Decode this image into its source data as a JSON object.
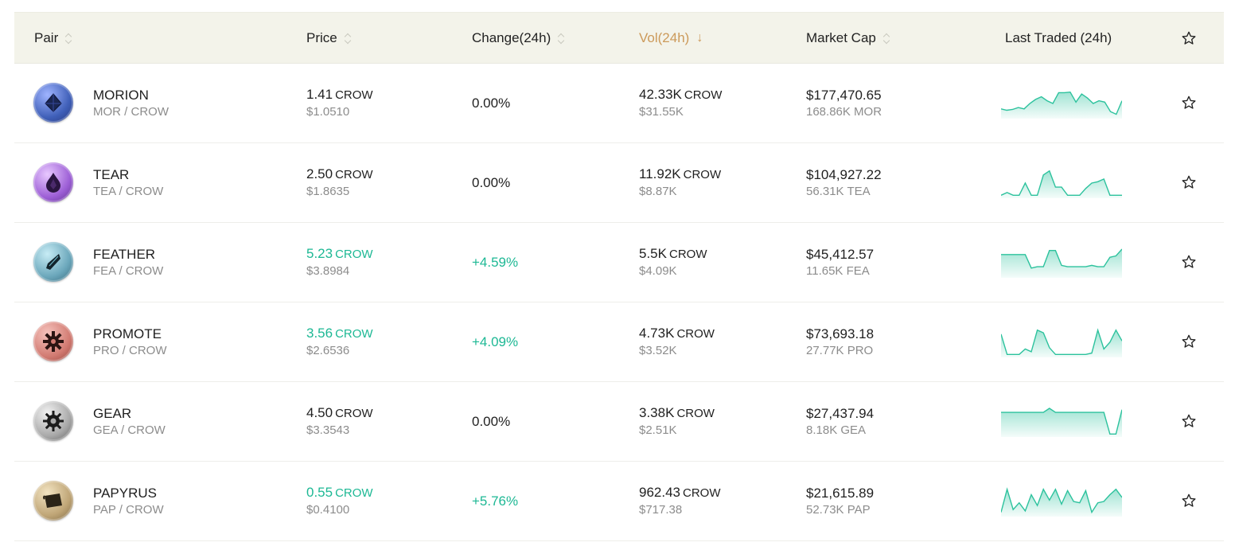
{
  "header": {
    "pair": "Pair",
    "price": "Price",
    "change": "Change(24h)",
    "vol": "Vol(24h)",
    "market_cap": "Market Cap",
    "last_traded": "Last Traded (24h)"
  },
  "colors": {
    "accent": "#cc9a5a",
    "positive": "#1db894",
    "spark_line": "#2cc29d",
    "header_bg": "#f3f3ea"
  },
  "rows": [
    {
      "name": "MORION",
      "pair": "MOR / CROW",
      "price": "1.41",
      "price_unit": "CROW",
      "price_usd": "$1.0510",
      "change": "0.00%",
      "vol": "42.33K",
      "vol_unit": "CROW",
      "vol_usd": "$31.55K",
      "mcap": "$177,470.65",
      "mcap_sub": "168.86K MOR",
      "positive": false,
      "icon": "morion-coin-icon",
      "spark": [
        0.3,
        0.25,
        0.28,
        0.35,
        0.3,
        0.5,
        0.65,
        0.75,
        0.6,
        0.5,
        0.9,
        0.9,
        0.92,
        0.55,
        0.85,
        0.7,
        0.5,
        0.6,
        0.55,
        0.2,
        0.1,
        0.6
      ]
    },
    {
      "name": "TEAR",
      "pair": "TEA / CROW",
      "price": "2.50",
      "price_unit": "CROW",
      "price_usd": "$1.8635",
      "change": "0.00%",
      "vol": "11.92K",
      "vol_unit": "CROW",
      "vol_usd": "$8.87K",
      "mcap": "$104,927.22",
      "mcap_sub": "56.31K TEA",
      "positive": false,
      "icon": "tear-coin-icon",
      "spark": [
        0.05,
        0.15,
        0.05,
        0.05,
        0.5,
        0.05,
        0.05,
        0.8,
        0.95,
        0.35,
        0.35,
        0.05,
        0.05,
        0.05,
        0.3,
        0.5,
        0.55,
        0.65,
        0.05,
        0.05,
        0.05
      ]
    },
    {
      "name": "FEATHER",
      "pair": "FEA / CROW",
      "price": "5.23",
      "price_unit": "CROW",
      "price_usd": "$3.8984",
      "change": "+4.59%",
      "vol": "5.5K",
      "vol_unit": "CROW",
      "vol_usd": "$4.09K",
      "mcap": "$45,412.57",
      "mcap_sub": "11.65K FEA",
      "positive": true,
      "icon": "feather-coin-icon",
      "spark": [
        0.8,
        0.8,
        0.8,
        0.8,
        0.8,
        0.3,
        0.35,
        0.35,
        0.95,
        0.95,
        0.4,
        0.35,
        0.35,
        0.35,
        0.35,
        0.4,
        0.35,
        0.35,
        0.7,
        0.75,
        1.0
      ]
    },
    {
      "name": "PROMOTE",
      "pair": "PRO / CROW",
      "price": "3.56",
      "price_unit": "CROW",
      "price_usd": "$2.6536",
      "change": "+4.09%",
      "vol": "4.73K",
      "vol_unit": "CROW",
      "vol_usd": "$3.52K",
      "mcap": "$73,693.18",
      "mcap_sub": "27.77K PRO",
      "positive": true,
      "icon": "promote-coin-icon",
      "spark": [
        0.8,
        0.05,
        0.05,
        0.05,
        0.25,
        0.15,
        0.95,
        0.85,
        0.3,
        0.05,
        0.05,
        0.05,
        0.05,
        0.05,
        0.05,
        0.1,
        0.95,
        0.25,
        0.5,
        0.95,
        0.55
      ]
    },
    {
      "name": "GEAR",
      "pair": "GEA / CROW",
      "price": "4.50",
      "price_unit": "CROW",
      "price_usd": "$3.3543",
      "change": "0.00%",
      "vol": "3.38K",
      "vol_unit": "CROW",
      "vol_usd": "$2.51K",
      "mcap": "$27,437.94",
      "mcap_sub": "8.18K GEA",
      "positive": false,
      "icon": "gear-coin-icon",
      "spark": [
        0.85,
        0.85,
        0.85,
        0.85,
        0.85,
        0.85,
        0.85,
        0.85,
        1.0,
        0.85,
        0.85,
        0.85,
        0.85,
        0.85,
        0.85,
        0.85,
        0.85,
        0.85,
        0.05,
        0.05,
        0.95
      ]
    },
    {
      "name": "PAPYRUS",
      "pair": "PAP / CROW",
      "price": "0.55",
      "price_unit": "CROW",
      "price_usd": "$0.4100",
      "change": "+5.76%",
      "vol": "962.43",
      "vol_unit": "CROW",
      "vol_usd": "$717.38",
      "mcap": "$21,615.89",
      "mcap_sub": "52.73K PAP",
      "positive": true,
      "icon": "papyrus-coin-icon",
      "spark": [
        0.1,
        0.95,
        0.2,
        0.45,
        0.15,
        0.75,
        0.35,
        0.95,
        0.55,
        0.95,
        0.4,
        0.9,
        0.5,
        0.45,
        0.9,
        0.1,
        0.45,
        0.5,
        0.75,
        0.95,
        0.65
      ]
    }
  ]
}
